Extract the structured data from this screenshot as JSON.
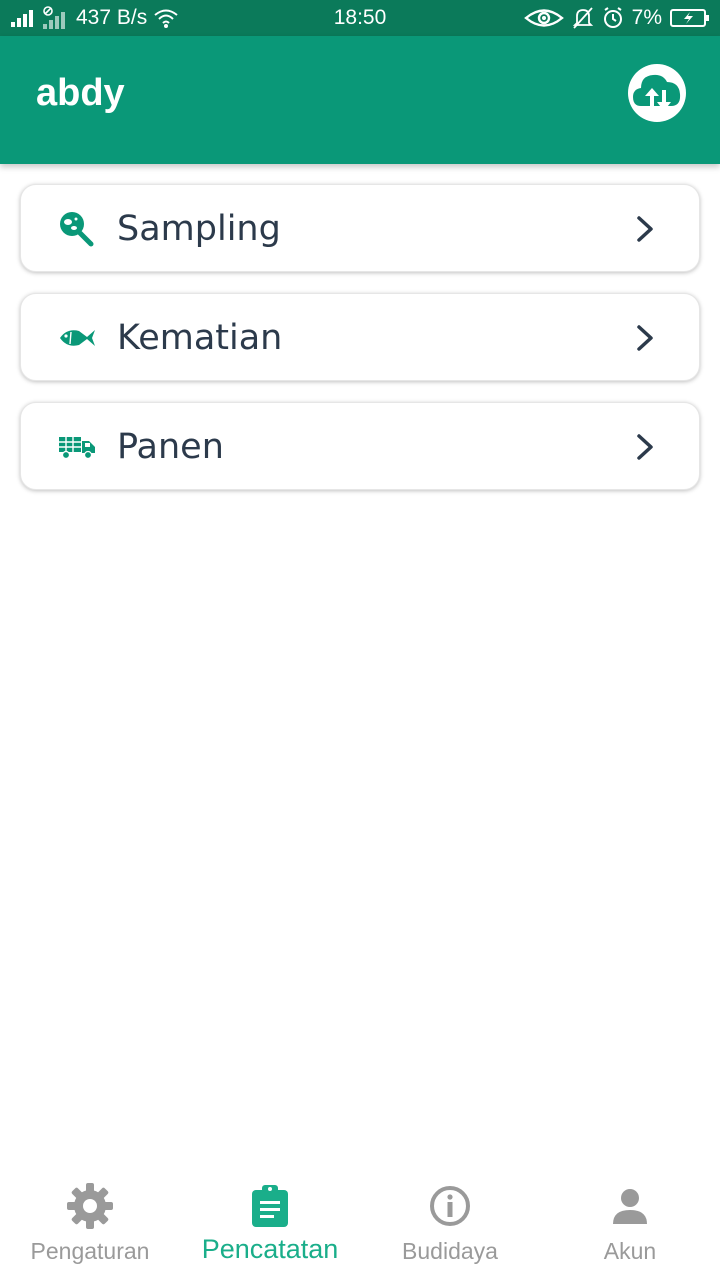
{
  "status_bar": {
    "net_speed": "437 B/s",
    "time": "18:50",
    "battery": "7%"
  },
  "app_bar": {
    "title": "abdy",
    "action_icon": "cloud-sync-icon"
  },
  "menu": {
    "items": [
      {
        "label": "Sampling",
        "icon": "magnifier-bacteria-icon"
      },
      {
        "label": "Kematian",
        "icon": "fish-icon"
      },
      {
        "label": "Panen",
        "icon": "truck-icon"
      }
    ]
  },
  "bottom_nav": {
    "items": [
      {
        "label": "Pengaturan",
        "icon": "gear-icon",
        "active": false
      },
      {
        "label": "Pencatatan",
        "icon": "clipboard-icon",
        "active": true
      },
      {
        "label": "Budidaya",
        "icon": "info-icon",
        "active": false
      },
      {
        "label": "Akun",
        "icon": "person-icon",
        "active": false
      }
    ]
  },
  "colors": {
    "status_bar": "#0b7a5a",
    "primary": "#0a9878",
    "accent": "#1aae8a",
    "text_dark": "#2c3a4b",
    "inactive": "#9a9a9a"
  }
}
